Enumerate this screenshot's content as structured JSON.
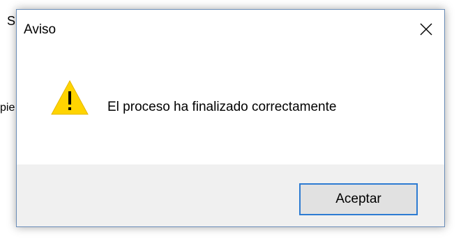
{
  "background": {
    "top_label": "S",
    "side_label": "pie"
  },
  "dialog": {
    "title": "Aviso",
    "message": "El proceso ha finalizado correctamente",
    "accept_label": "Aceptar",
    "icon": "warning-icon",
    "close_icon": "close-icon"
  },
  "colors": {
    "button_border": "#2d7bd2",
    "button_bg": "#e1e1e1",
    "footer_bg": "#f0f0f0",
    "warning_yellow": "#ffd400"
  }
}
